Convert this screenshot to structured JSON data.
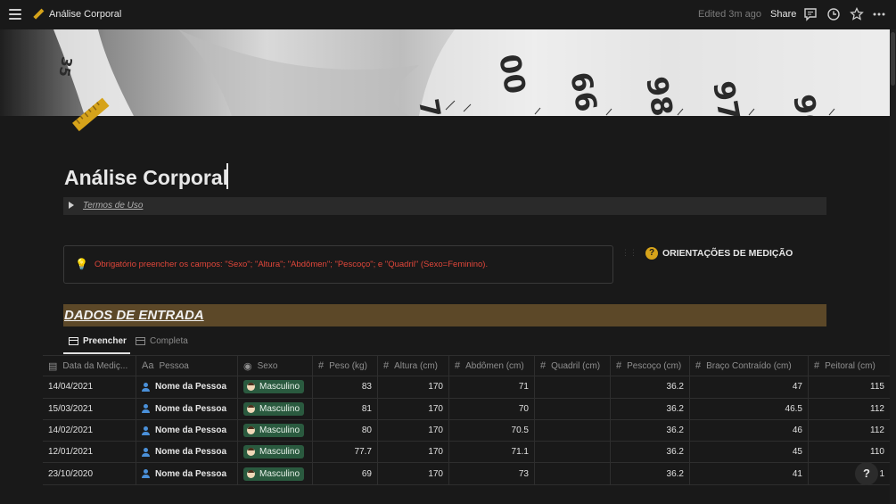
{
  "topbar": {
    "page_title": "Análise Corporal",
    "edited": "Edited 3m ago",
    "share": "Share"
  },
  "page": {
    "title": "Análise Corporal",
    "toggle_label": "Termos de Uso",
    "callout_text": "Obrigatório preencher os campos: \"Sexo\"; \"Altura\"; \"Abdômen\"; \"Pescoço\"; e \"Quadril\" (Sexo=Feminino).",
    "orientation_link": "ORIENTAÇÕES DE MEDIÇÃO",
    "section_heading": "DADOS DE ENTRADA",
    "help": "?"
  },
  "tabs": [
    {
      "label": "Preencher",
      "active": true
    },
    {
      "label": "Completa",
      "active": false
    }
  ],
  "table": {
    "headers": [
      "Data da Mediç...",
      "Pessoa",
      "Sexo",
      "Peso (kg)",
      "Altura (cm)",
      "Abdômen (cm)",
      "Quadril (cm)",
      "Pescoço (cm)",
      "Braço Contraído (cm)",
      "Peitoral (cm)"
    ],
    "rows": [
      {
        "date": "14/04/2021",
        "person": "Nome da Pessoa",
        "sex": "Masculino",
        "peso": "83",
        "altura": "170",
        "abdomen": "71",
        "quadril": "",
        "pescoco": "36.2",
        "braco": "47",
        "peitoral": "115"
      },
      {
        "date": "15/03/2021",
        "person": "Nome da Pessoa",
        "sex": "Masculino",
        "peso": "81",
        "altura": "170",
        "abdomen": "70",
        "quadril": "",
        "pescoco": "36.2",
        "braco": "46.5",
        "peitoral": "112"
      },
      {
        "date": "14/02/2021",
        "person": "Nome da Pessoa",
        "sex": "Masculino",
        "peso": "80",
        "altura": "170",
        "abdomen": "70.5",
        "quadril": "",
        "pescoco": "36.2",
        "braco": "46",
        "peitoral": "112"
      },
      {
        "date": "12/01/2021",
        "person": "Nome da Pessoa",
        "sex": "Masculino",
        "peso": "77.7",
        "altura": "170",
        "abdomen": "71.1",
        "quadril": "",
        "pescoco": "36.2",
        "braco": "45",
        "peitoral": "110"
      },
      {
        "date": "23/10/2020",
        "person": "Nome da Pessoa",
        "sex": "Masculino",
        "peso": "69",
        "altura": "170",
        "abdomen": "73",
        "quadril": "",
        "pescoco": "36.2",
        "braco": "41",
        "peitoral": "1"
      }
    ]
  },
  "colors": {
    "heading_bg": "#5c4828",
    "callout_text": "#e0463a",
    "tag_bg": "#2a5a3f",
    "accent_icon": "#d6a31a"
  }
}
